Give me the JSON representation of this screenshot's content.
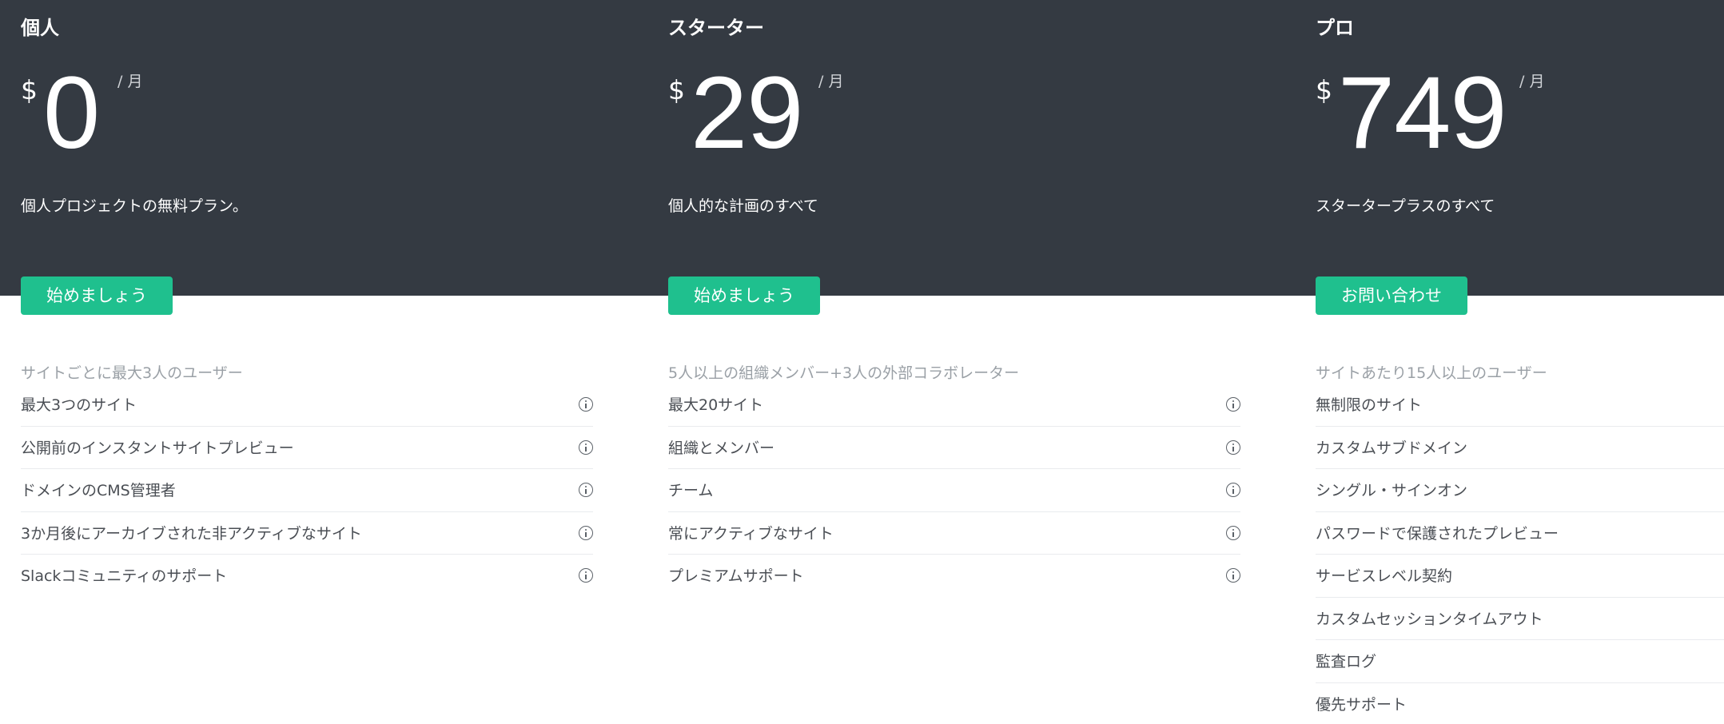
{
  "plans": [
    {
      "name": "個人",
      "currency": "$",
      "price": "0",
      "period": "/ 月",
      "description": "個人プロジェクトの無料プラン。",
      "cta_label": "始めましょう",
      "features_header": "サイトごとに最大3人のユーザー",
      "features": [
        {
          "label": "最大3つのサイト",
          "info_icon": "info-icon"
        },
        {
          "label": "公開前のインスタントサイトプレビュー",
          "info_icon": "info-icon"
        },
        {
          "label": "ドメインのCMS管理者",
          "info_icon": "info-icon"
        },
        {
          "label": "3か月後にアーカイブされた非アクティブなサイト",
          "info_icon": "info-icon"
        },
        {
          "label": "Slackコミュニティのサポート",
          "info_icon": "info-icon"
        }
      ]
    },
    {
      "name": "スターター",
      "currency": "$",
      "price": "29",
      "period": "/ 月",
      "description": "個人的な計画のすべて",
      "cta_label": "始めましょう",
      "features_header": "5人以上の組織メンバー+3人の外部コラボレーター",
      "features": [
        {
          "label": "最大20サイト",
          "info_icon": "info-icon"
        },
        {
          "label": "組織とメンバー",
          "info_icon": "info-icon"
        },
        {
          "label": "チーム",
          "info_icon": "info-icon"
        },
        {
          "label": "常にアクティブなサイト",
          "info_icon": "info-icon"
        },
        {
          "label": "プレミアムサポート",
          "info_icon": "info-icon"
        }
      ]
    },
    {
      "name": "プロ",
      "currency": "$",
      "price": "749",
      "period": "/ 月",
      "description": "スタータープラスのすべて",
      "cta_label": "お問い合わせ",
      "features_header": "サイトあたり15人以上のユーザー",
      "features": [
        {
          "label": "無制限のサイト"
        },
        {
          "label": "カスタムサブドメイン"
        },
        {
          "label": "シングル・サインオン"
        },
        {
          "label": "パスワードで保護されたプレビュー"
        },
        {
          "label": "サービスレベル契約"
        },
        {
          "label": "カスタムセッションタイムアウト"
        },
        {
          "label": "監査ログ"
        },
        {
          "label": "優先サポート"
        }
      ]
    }
  ],
  "colors": {
    "header_bg": "#343a42",
    "accent": "#1fc08e",
    "text": "#4a4e54",
    "muted": "#9aa0a6"
  }
}
